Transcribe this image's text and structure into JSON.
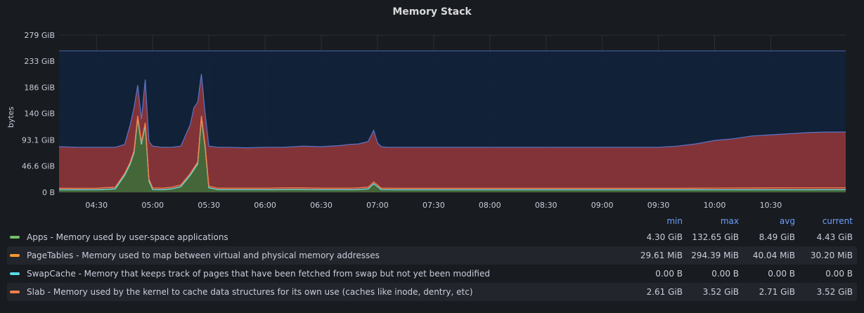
{
  "panel": {
    "title": "Memory Stack"
  },
  "chart_data": {
    "type": "area",
    "title": "Memory Stack",
    "ylabel": "bytes",
    "xlabel": "",
    "y_ticks": [
      "0 B",
      "46.6 GiB",
      "93.1 GiB",
      "140 GiB",
      "186 GiB",
      "233 GiB",
      "279 GiB"
    ],
    "y_tick_values_gib": [
      0,
      46.6,
      93.1,
      140,
      186,
      233,
      279
    ],
    "ylim_gib": [
      0,
      279
    ],
    "x_ticks": [
      "04:30",
      "05:00",
      "05:30",
      "06:00",
      "06:30",
      "07:00",
      "07:30",
      "08:00",
      "08:30",
      "09:00",
      "09:30",
      "10:00",
      "10:30"
    ],
    "x_range": [
      "04:10",
      "11:10"
    ],
    "total_memory_gib": 251,
    "grid": true,
    "legend_placement": "bottom-table",
    "colors": {
      "apps": "#73bf69",
      "page_tables": "#ff9830",
      "swap_cache": "#5ad8e6",
      "slab": "#f2804a",
      "stack": "#a83a3a",
      "stack_line": "#5b74c9",
      "total_fill": "#11223a",
      "total_line": "#3f5a93"
    },
    "x": [
      "04:10",
      "04:20",
      "04:30",
      "04:40",
      "04:45",
      "04:48",
      "04:50",
      "04:52",
      "04:54",
      "04:56",
      "04:58",
      "05:00",
      "05:05",
      "05:10",
      "05:15",
      "05:20",
      "05:22",
      "05:24",
      "05:26",
      "05:28",
      "05:30",
      "05:35",
      "05:40",
      "05:50",
      "06:00",
      "06:10",
      "06:20",
      "06:30",
      "06:40",
      "06:45",
      "06:50",
      "06:55",
      "06:58",
      "07:00",
      "07:02",
      "07:05",
      "07:10",
      "07:30",
      "08:00",
      "08:30",
      "09:00",
      "09:30",
      "09:40",
      "09:50",
      "10:00",
      "10:10",
      "10:20",
      "10:30",
      "10:40",
      "10:50",
      "11:00",
      "11:10"
    ],
    "series": [
      {
        "name": "Apps - Memory used by user-space applications",
        "values": [
          4.4,
          4.4,
          4.5,
          6,
          30,
          50,
          70,
          132,
          85,
          120,
          20,
          5,
          4.5,
          6,
          10,
          30,
          40,
          50,
          132,
          80,
          8,
          4.5,
          4.5,
          4.5,
          4.5,
          5,
          5,
          4.5,
          4.5,
          4.6,
          5,
          6,
          15,
          10,
          4.5,
          4.5,
          4.4,
          4.4,
          4.4,
          4.4,
          4.4,
          4.4,
          4.4,
          4.4,
          4.4,
          4.4,
          4.4,
          4.4,
          4.4,
          4.4,
          4.43,
          4.43
        ]
      },
      {
        "name": "PageTables - Memory used to map between virtual and physical memory addresses",
        "values": [
          0.03,
          0.03,
          0.03,
          0.04,
          0.1,
          0.15,
          0.2,
          0.29,
          0.2,
          0.25,
          0.05,
          0.03,
          0.03,
          0.04,
          0.05,
          0.1,
          0.15,
          0.2,
          0.29,
          0.2,
          0.04,
          0.03,
          0.03,
          0.03,
          0.03,
          0.03,
          0.03,
          0.03,
          0.03,
          0.03,
          0.03,
          0.04,
          0.06,
          0.05,
          0.03,
          0.03,
          0.03,
          0.03,
          0.03,
          0.03,
          0.03,
          0.03,
          0.03,
          0.03,
          0.03,
          0.03,
          0.03,
          0.03,
          0.03,
          0.03,
          0.03,
          0.03
        ]
      },
      {
        "name": "SwapCache - Memory that keeps track of pages that have been fetched from swap but not yet been modified",
        "values": [
          0,
          0,
          0,
          0,
          0,
          0,
          0,
          0,
          0,
          0,
          0,
          0,
          0,
          0,
          0,
          0,
          0,
          0,
          0,
          0,
          0,
          0,
          0,
          0,
          0,
          0,
          0,
          0,
          0,
          0,
          0,
          0,
          0,
          0,
          0,
          0,
          0,
          0,
          0,
          0,
          0,
          0,
          0,
          0,
          0,
          0,
          0,
          0,
          0,
          0,
          0,
          0
        ]
      },
      {
        "name": "Slab - Memory used by the kernel to cache data structures for its own use (caches like inode, dentry, etc)",
        "values": [
          2.7,
          2.6,
          2.65,
          3,
          3.2,
          3.3,
          3.5,
          3.5,
          3.3,
          3.4,
          3,
          2.7,
          2.7,
          2.8,
          3,
          3.2,
          3.3,
          3.4,
          3.5,
          3.3,
          2.9,
          2.7,
          2.7,
          2.7,
          2.7,
          2.8,
          2.8,
          2.7,
          2.7,
          2.7,
          2.8,
          3,
          3.3,
          3.1,
          2.7,
          2.7,
          2.7,
          2.7,
          2.7,
          2.7,
          2.7,
          2.7,
          2.7,
          2.8,
          3,
          3.2,
          3.3,
          3.4,
          3.5,
          3.5,
          3.52,
          3.52
        ]
      }
    ],
    "stack_total_gib": [
      81,
      80,
      80,
      80,
      85,
      120,
      150,
      190,
      130,
      200,
      90,
      82,
      80,
      80,
      82,
      120,
      150,
      160,
      210,
      140,
      82,
      80,
      80,
      79,
      80,
      80,
      82,
      81,
      83,
      85,
      86,
      90,
      110,
      88,
      81,
      80,
      80,
      80,
      80,
      80,
      80,
      80,
      82,
      86,
      92,
      95,
      100,
      102,
      104,
      106,
      107,
      107
    ]
  },
  "legend": {
    "headers": {
      "min": "min",
      "max": "max",
      "avg": "avg",
      "current": "current"
    },
    "rows": [
      {
        "name": "Apps - Memory used by user-space applications",
        "min": "4.30 GiB",
        "max": "132.65 GiB",
        "avg": "8.49 GiB",
        "current": "4.43 GiB"
      },
      {
        "name": "PageTables - Memory used to map between virtual and physical memory addresses",
        "min": "29.61 MiB",
        "max": "294.39 MiB",
        "avg": "40.04 MiB",
        "current": "30.20 MiB"
      },
      {
        "name": "SwapCache - Memory that keeps track of pages that have been fetched from swap but not yet been modified",
        "min": "0.00 B",
        "max": "0.00 B",
        "avg": "0.00 B",
        "current": "0.00 B"
      },
      {
        "name": "Slab - Memory used by the kernel to cache data structures for its own use (caches like inode, dentry, etc)",
        "min": "2.61 GiB",
        "max": "3.52 GiB",
        "avg": "2.71 GiB",
        "current": "3.52 GiB"
      }
    ]
  }
}
